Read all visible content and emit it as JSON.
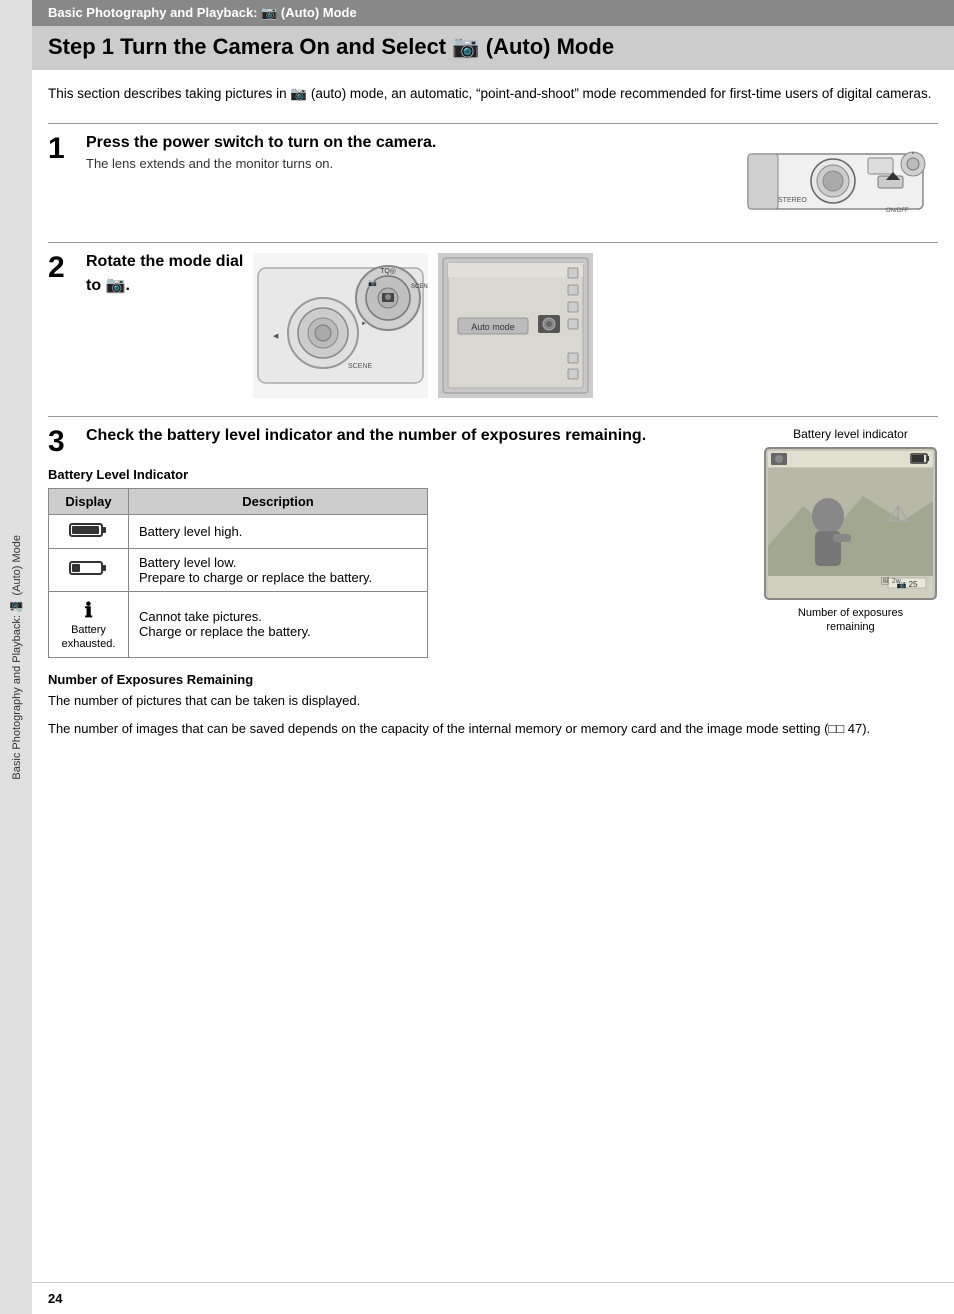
{
  "header": {
    "bar_text": "Basic Photography and Playback: 📷 (Auto) Mode",
    "title": "Step 1 Turn the Camera On and Select 📷 (Auto) Mode"
  },
  "sidebar": {
    "text": "Basic Photography and Playback: 📷 (Auto) Mode"
  },
  "intro": {
    "text": "This section describes taking pictures in 📷 (auto) mode, an automatic, “point-and-shoot” mode recommended for first-time users of digital cameras."
  },
  "steps": [
    {
      "number": "1",
      "title": "Press the power switch to turn on the camera.",
      "description": "The lens extends and the monitor turns on."
    },
    {
      "number": "2",
      "title": "Rotate the mode dial",
      "title2": "to 📷.",
      "auto_mode_label": "Auto mode"
    },
    {
      "number": "3",
      "title": "Check the battery level indicator and the number of exposures remaining.",
      "battery_section_title": "Battery Level Indicator",
      "table_headers": [
        "Display",
        "Description"
      ],
      "table_rows": [
        {
          "display": "battery_full",
          "description": "Battery level high."
        },
        {
          "display": "battery_low",
          "description": "Battery level low.\nPrepare to charge or replace the battery."
        },
        {
          "display": "battery_exhausted",
          "display_label": "Battery\nexhausted.",
          "description": "Cannot take pictures.\nCharge or replace the battery."
        }
      ],
      "battery_indicator_label": "Battery level indicator",
      "exposures_remaining_label": "Number of exposures\nremaining",
      "exposures_section_title": "Number of Exposures Remaining",
      "exposures_text1": "The number of pictures that can be taken is displayed.",
      "exposures_text2": "The number of images that can be saved depends on the capacity of the internal memory or memory card and the image mode setting (□□ 47)."
    }
  ],
  "page_number": "24"
}
